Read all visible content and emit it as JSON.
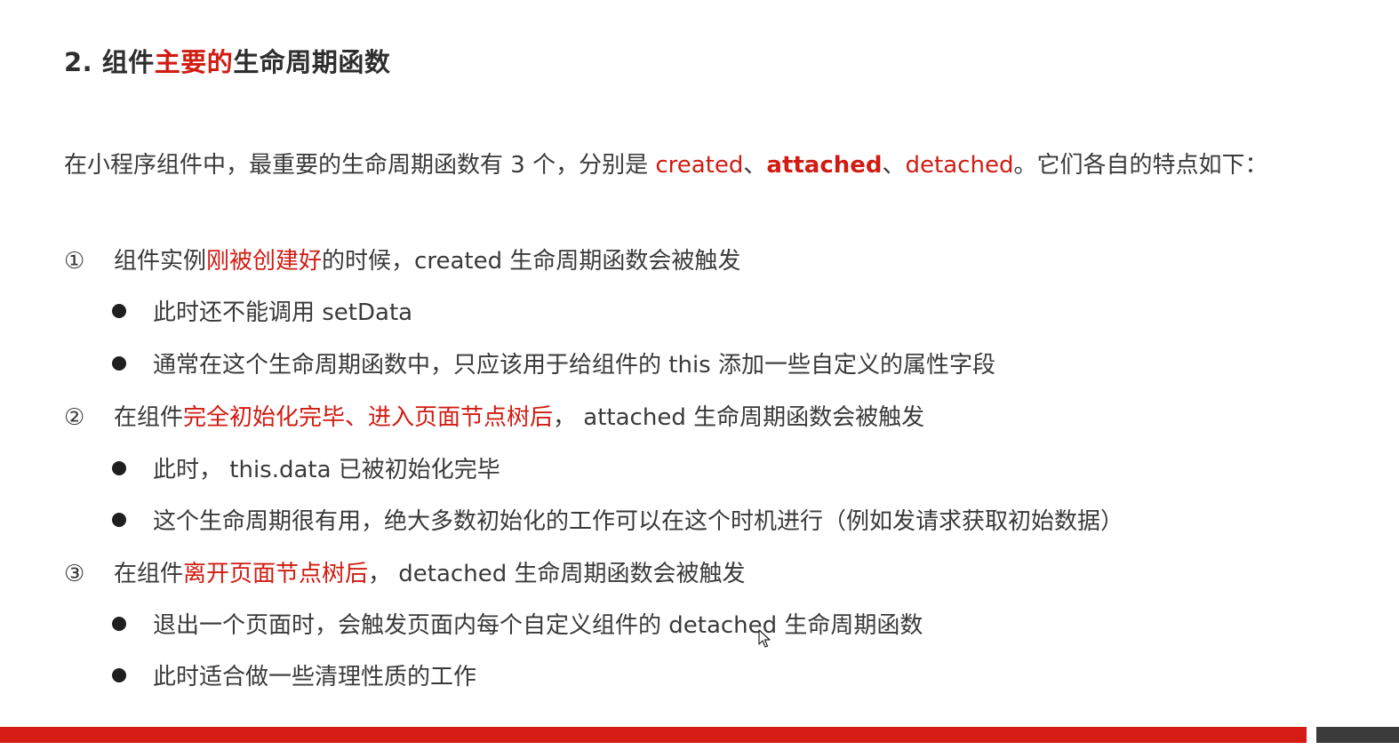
{
  "heading": {
    "prefix": "2. 组件",
    "highlight": "主要的",
    "suffix": "生命周期函数"
  },
  "intro": {
    "text1": "在小程序组件中，最重要的生命周期函数有 3 个，分别是 ",
    "created": "created",
    "sep1": "、",
    "attached": "attached",
    "sep2": "、",
    "detached": "detached",
    "text2": "。它们各自的特点如下："
  },
  "items": [
    {
      "num": "①",
      "pre": "组件实例",
      "hl": "刚被创建好",
      "post": "的时候，created 生命周期函数会被触发",
      "bullets": [
        "此时还不能调用 setData",
        "通常在这个生命周期函数中，只应该用于给组件的 this 添加一些自定义的属性字段"
      ]
    },
    {
      "num": "②",
      "pre": "在组件",
      "hl": "完全初始化完毕、进入页面节点树后",
      "post": "， attached 生命周期函数会被触发",
      "bullets": [
        "此时， this.data 已被初始化完毕",
        "这个生命周期很有用，绝大多数初始化的工作可以在这个时机进行（例如发请求获取初始数据）"
      ]
    },
    {
      "num": "③",
      "pre": "在组件",
      "hl": "离开页面节点树后",
      "post": "， detached 生命周期函数会被触发",
      "bullets": [
        "退出一个页面时，会触发页面内每个自定义组件的 detached 生命周期函数",
        "此时适合做一些清理性质的工作"
      ]
    }
  ],
  "colors": {
    "accent": "#d01c12",
    "text": "#3a3a3a",
    "footer_red": "#d51b14",
    "footer_dark": "#3b3b3b"
  },
  "icons": {
    "cursor": "mouse-pointer-icon",
    "bullet": "bullet-dot-icon"
  }
}
